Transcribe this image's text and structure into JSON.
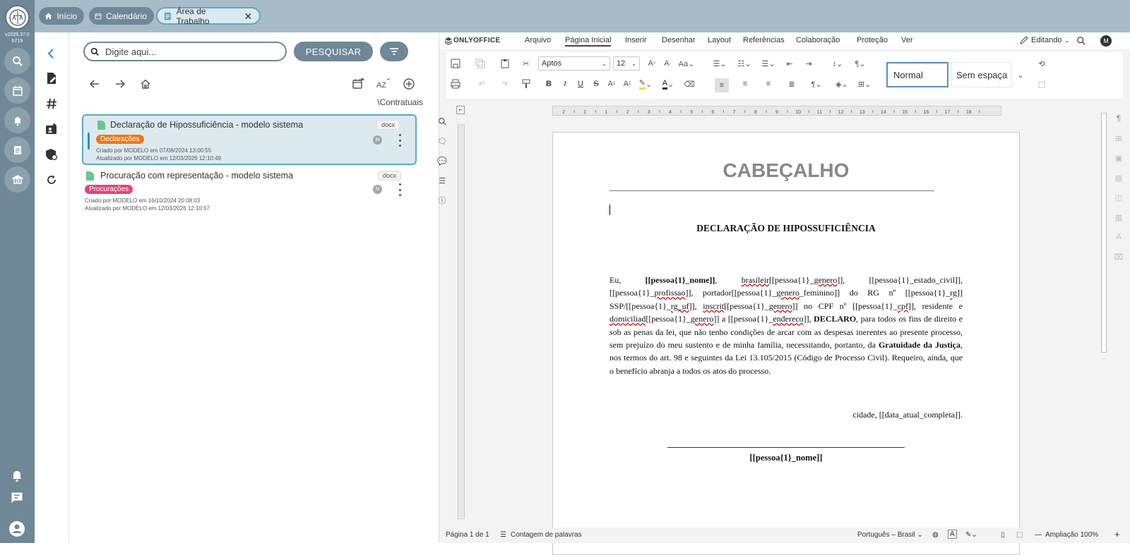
{
  "app": {
    "version": "v2026.37.0",
    "build": "b719"
  },
  "tabs": [
    {
      "label": "Início",
      "icon": "home-icon"
    },
    {
      "label": "Calendário",
      "icon": "calendar-icon"
    },
    {
      "label": "Área de Trabalho",
      "icon": "document-icon"
    }
  ],
  "search": {
    "placeholder": "Digite aqui...",
    "button_label": "PESQUISAR"
  },
  "path": "\\Contratuais",
  "files": [
    {
      "title": "Declaração de Hipossuficiência - modelo sistema",
      "ext": "docx",
      "tag": "Declarações",
      "tag_color": "#e8791c",
      "created": "Criado por MODELO em 07/08/2024 13:00:55",
      "updated": "Atualizado por MODELO em 12/03/2026 12:10:49",
      "avatar": "M"
    },
    {
      "title": "Procuração com representação - modelo sistema",
      "ext": "docx",
      "tag": "Procurações",
      "tag_color": "#e0457b",
      "created": "Criado por MODELO em 16/10/2024 20:08:03",
      "updated": "Atualizado por MODELO em 12/03/2026 12:10:57",
      "avatar": "M"
    }
  ],
  "editor": {
    "brand": "ONLYOFFICE",
    "menu": [
      "Arquivo",
      "Página Inicial",
      "Inserir",
      "Desenhar",
      "Layout",
      "Referências",
      "Colaboração",
      "Proteção",
      "Ver"
    ],
    "mode": "Editando",
    "user_avatar": "M",
    "font": "Aptos",
    "size": "12",
    "style_normal": "Normal",
    "style_nospace": "Sem espaça",
    "ruler": [
      "2",
      "1",
      "1",
      "2",
      "3",
      "4",
      "5",
      "6",
      "7",
      "8",
      "9",
      "10",
      "11",
      "12",
      "13",
      "14",
      "15",
      "16",
      "17",
      "18"
    ]
  },
  "doc": {
    "header": "CABEÇALHO",
    "title": "DECLARAÇÃO DE HIPOSSUFICIÊNCIA",
    "place_date": "cidade, [[data_atual_completa]].",
    "signature_name": "[[pessoa{1}_nome]]"
  },
  "status": {
    "page": "Página 1 de 1",
    "word_count": "Contagem de palavras",
    "language": "Português – Brasil",
    "zoom": "Ampliação 100%"
  },
  "colors": {
    "topbar": "#a8bcc8",
    "rail": "#6f8797",
    "accent": "#5aa9c9"
  }
}
